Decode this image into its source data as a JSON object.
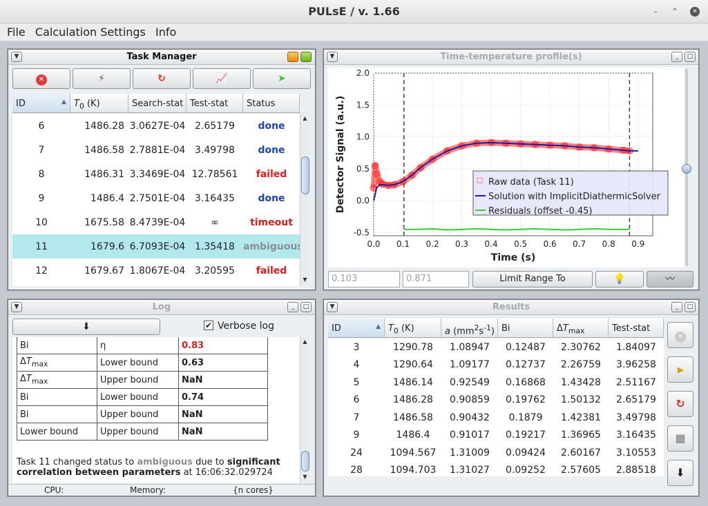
{
  "window": {
    "title": "PULsE / v. 1.66"
  },
  "menu": [
    "File",
    "Calculation Settings",
    "Info"
  ],
  "task_manager": {
    "title": "Task Manager",
    "columns": [
      "ID",
      "T0 (K)",
      "Search-stat",
      "Test-stat",
      "Status"
    ],
    "rows": [
      {
        "id": "6",
        "t0": "1486.28",
        "search": "3.0627E-04",
        "test": "2.65179",
        "status": "done"
      },
      {
        "id": "7",
        "t0": "1486.58",
        "search": "2.7881E-04",
        "test": "3.49798",
        "status": "done"
      },
      {
        "id": "8",
        "t0": "1486.31",
        "search": "3.3469E-04",
        "test": "12.78561",
        "status": "failed"
      },
      {
        "id": "9",
        "t0": "1486.4",
        "search": "2.7501E-04",
        "test": "3.16435",
        "status": "done"
      },
      {
        "id": "10",
        "t0": "1675.58",
        "search": "8.4739E-04",
        "test": "∞",
        "status": "timeout"
      },
      {
        "id": "11",
        "t0": "1679.6",
        "search": "6.7093E-04",
        "test": "1.35418",
        "status": "ambiguous"
      },
      {
        "id": "12",
        "t0": "1679.67",
        "search": "1.8067E-04",
        "test": "3.20595",
        "status": "failed"
      }
    ]
  },
  "chart_panel": {
    "title": "Time-temperature profile(s)",
    "range_from": "0.103",
    "range_to": "0.871",
    "limit_button": "Limit Range To"
  },
  "chart_data": {
    "type": "scatter",
    "title": "",
    "xlabel": "Time (s)",
    "ylabel": "Detector Signal (a.u.)",
    "xlim": [
      0.0,
      0.95
    ],
    "ylim": [
      -0.55,
      2.0
    ],
    "x_ticks": [
      "0.0",
      "0.1",
      "0.2",
      "0.3",
      "0.4",
      "0.5",
      "0.6",
      "0.7",
      "0.8",
      "0.9"
    ],
    "y_ticks": [
      "-0.5",
      "0.0",
      "0.5",
      "1.0",
      "1.5",
      "2.0"
    ],
    "range_markers": [
      0.103,
      0.871
    ],
    "legend_position": "bottom-right",
    "series": [
      {
        "name": "Raw data (Task 11)",
        "color": "#ff2020",
        "x": [
          0.0,
          0.005,
          0.01,
          0.02,
          0.03,
          0.05,
          0.07,
          0.1,
          0.13,
          0.16,
          0.2,
          0.25,
          0.3,
          0.35,
          0.4,
          0.45,
          0.5,
          0.55,
          0.6,
          0.65,
          0.7,
          0.75,
          0.8,
          0.85,
          0.871
        ],
        "y": [
          0.2,
          0.55,
          0.42,
          0.3,
          0.26,
          0.24,
          0.25,
          0.3,
          0.4,
          0.52,
          0.65,
          0.78,
          0.86,
          0.9,
          0.91,
          0.9,
          0.89,
          0.88,
          0.87,
          0.86,
          0.84,
          0.83,
          0.81,
          0.79,
          0.78
        ]
      },
      {
        "name": "Solution with ImplicitDiathermicSolver",
        "color": "#1a1aa8",
        "x": [
          0.0,
          0.01,
          0.02,
          0.03,
          0.05,
          0.07,
          0.1,
          0.13,
          0.16,
          0.2,
          0.25,
          0.3,
          0.35,
          0.4,
          0.45,
          0.5,
          0.55,
          0.6,
          0.65,
          0.7,
          0.75,
          0.8,
          0.85,
          0.871,
          0.9
        ],
        "y": [
          0.0,
          0.2,
          0.25,
          0.25,
          0.24,
          0.25,
          0.3,
          0.4,
          0.52,
          0.65,
          0.78,
          0.86,
          0.9,
          0.91,
          0.9,
          0.89,
          0.88,
          0.87,
          0.86,
          0.84,
          0.83,
          0.81,
          0.79,
          0.78,
          0.78
        ]
      },
      {
        "name": "Residuals (offset -0.45)",
        "color": "#30d030",
        "x": [
          0.103,
          0.15,
          0.2,
          0.25,
          0.3,
          0.35,
          0.4,
          0.45,
          0.5,
          0.55,
          0.6,
          0.65,
          0.7,
          0.75,
          0.8,
          0.85,
          0.871
        ],
        "y": [
          -0.45,
          -0.45,
          -0.44,
          -0.46,
          -0.45,
          -0.44,
          -0.45,
          -0.46,
          -0.45,
          -0.44,
          -0.45,
          -0.46,
          -0.45,
          -0.44,
          -0.45,
          -0.45,
          -0.45
        ]
      }
    ]
  },
  "log": {
    "title": "Log",
    "verbose_label": "Verbose log",
    "table": [
      [
        "Bi",
        "η",
        "0.83"
      ],
      [
        "ΔTmax",
        "Lower bound",
        "0.63"
      ],
      [
        "ΔTmax",
        "Upper bound",
        "NaN"
      ],
      [
        "Bi",
        "Lower bound",
        "0.74"
      ],
      [
        "Bi",
        "Upper bound",
        "NaN"
      ],
      [
        "Lower bound",
        "Upper bound",
        "NaN"
      ]
    ],
    "msg_prefix": "Task 11 changed status to",
    "msg_status": "ambiguous",
    "msg_mid": "due to",
    "msg_reason1": "significant",
    "msg_reason2": "correlation between parameters",
    "msg_time": "at 16:06:32.029724",
    "status_cpu": "CPU:",
    "status_memory": "Memory:",
    "status_cores": "{n cores}"
  },
  "results": {
    "title": "Results",
    "columns": [
      "ID",
      "T0 (K)",
      "a (mm2s-1)",
      "Bi",
      "ΔTmax",
      "Test-stat"
    ],
    "rows": [
      [
        "3",
        "1290.78",
        "1.08947",
        "0.12487",
        "2.30762",
        "1.84097"
      ],
      [
        "4",
        "1290.64",
        "1.09177",
        "0.12737",
        "2.26759",
        "3.96258"
      ],
      [
        "5",
        "1486.14",
        "0.92549",
        "0.16868",
        "1.43428",
        "2.51167"
      ],
      [
        "6",
        "1486.28",
        "0.90859",
        "0.19762",
        "1.50132",
        "2.65179"
      ],
      [
        "7",
        "1486.58",
        "0.90432",
        "0.1879",
        "1.42381",
        "3.49798"
      ],
      [
        "9",
        "1486.4",
        "0.91017",
        "0.19217",
        "1.36965",
        "3.16435"
      ],
      [
        "24",
        "1094.567",
        "1.31009",
        "0.09424",
        "2.60167",
        "3.10553"
      ],
      [
        "28",
        "1094.703",
        "1.31027",
        "0.09252",
        "2.57605",
        "2.88518"
      ]
    ]
  },
  "colors": {
    "done": "#2246a8",
    "failed": "#d61f1f",
    "ambiguous": "#8a8f94",
    "selected_row": "#b3e8ec"
  }
}
